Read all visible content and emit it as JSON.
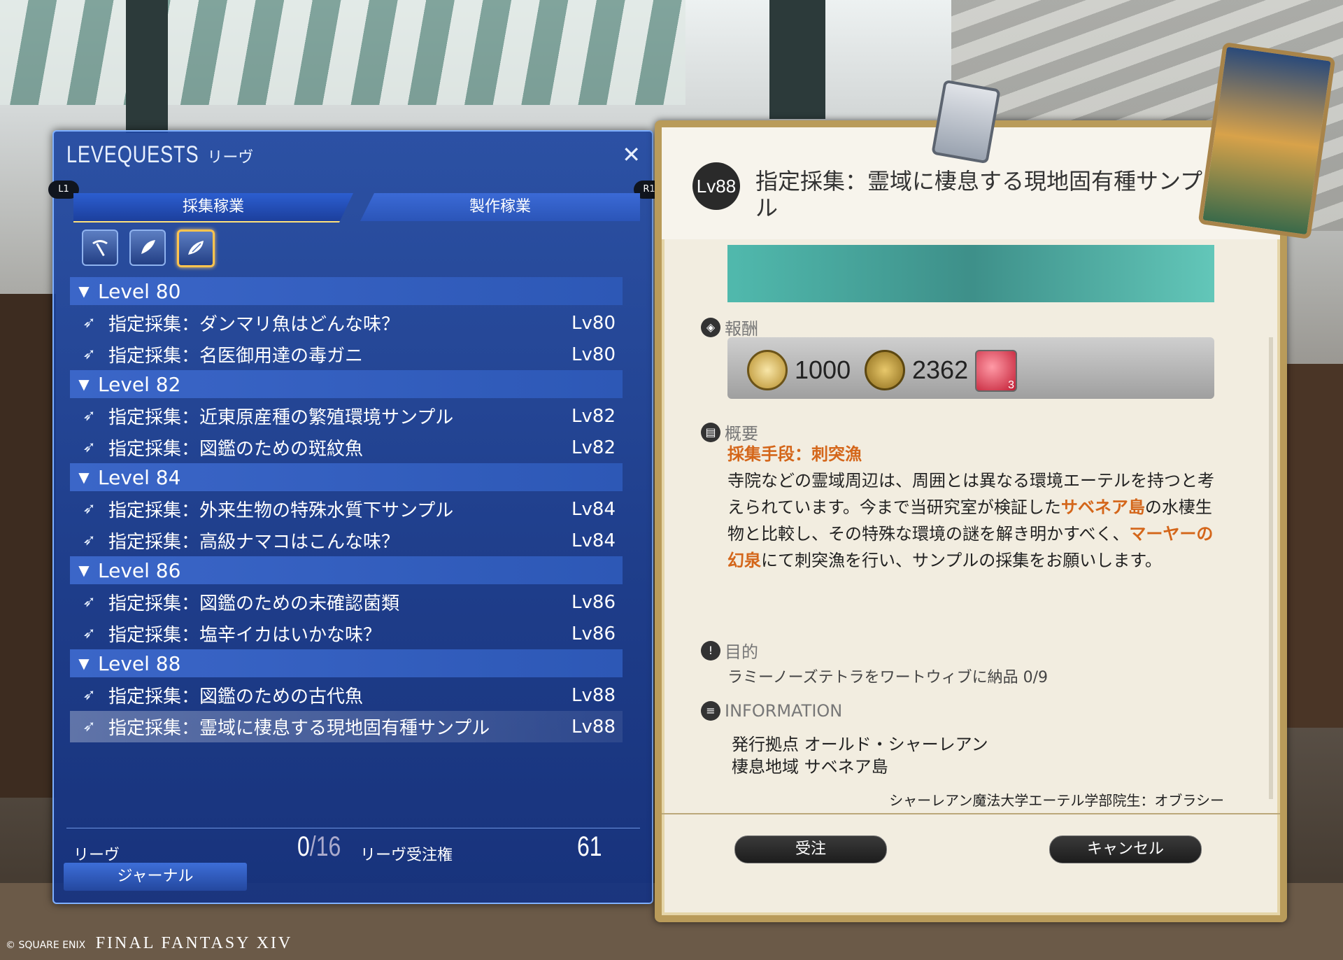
{
  "leve_panel": {
    "title_en": "LEVEQUESTS",
    "title_jp": "リーヴ",
    "close": "✕",
    "shoulder_left": "L1",
    "shoulder_right": "R1",
    "tabs": [
      "採集稼業",
      "製作稼業"
    ],
    "groups": [
      {
        "label": "Level 80",
        "quests": [
          {
            "name": "指定採集：ダンマリ魚はどんな味？",
            "lv": "Lv80"
          },
          {
            "name": "指定採集：名医御用達の毒ガニ",
            "lv": "Lv80"
          }
        ]
      },
      {
        "label": "Level 82",
        "quests": [
          {
            "name": "指定採集：近東原産種の繁殖環境サンプル",
            "lv": "Lv82"
          },
          {
            "name": "指定採集：図鑑のための斑紋魚",
            "lv": "Lv82"
          }
        ]
      },
      {
        "label": "Level 84",
        "quests": [
          {
            "name": "指定採集：外来生物の特殊水質下サンプル",
            "lv": "Lv84"
          },
          {
            "name": "指定採集：高級ナマコはこんな味？",
            "lv": "Lv84"
          }
        ]
      },
      {
        "label": "Level 86",
        "quests": [
          {
            "name": "指定採集：図鑑のための未確認菌類",
            "lv": "Lv86"
          },
          {
            "name": "指定採集：塩辛イカはいかな味？",
            "lv": "Lv86"
          }
        ]
      },
      {
        "label": "Level 88",
        "quests": [
          {
            "name": "指定採集：図鑑のための古代魚",
            "lv": "Lv88"
          },
          {
            "name": "指定採集：霊域に棲息する現地固有種サンプル",
            "lv": "Lv88"
          }
        ]
      }
    ],
    "footer": {
      "leve_label": "リーヴ",
      "leve_count": "0",
      "leve_max": "16",
      "allowance_label": "リーヴ受注権",
      "allowance_value": "61",
      "journal_button": "ジャーナル"
    }
  },
  "detail": {
    "level": "Lv88",
    "title": "指定採集：霊域に棲息する現地固有種サンプル",
    "reward_label": "報酬",
    "rewards": {
      "seals": "1000",
      "gil": "2362",
      "item_qty": "3"
    },
    "summary_label": "概要",
    "method": "採集手段：刺突漁",
    "summary_parts": [
      {
        "text": "寺院などの霊域周辺は、周囲とは異なる環境エーテルを持つと考えられています。今まで当研究室が検証した",
        "hl": false
      },
      {
        "text": "サベネア島",
        "hl": true
      },
      {
        "text": "の水棲生物と比較し、その特殊な環境の謎を解き明かすべく、",
        "hl": false
      },
      {
        "text": "マーヤーの幻泉",
        "hl": true
      },
      {
        "text": "にて刺突漁を行い、サンプルの採集をお願いします。",
        "hl": false
      }
    ],
    "objective_label": "目的",
    "objective": "ラミーノーズテトラをワートウィブに納品 0/9",
    "info_label": "INFORMATION",
    "info_lines": [
      "発行拠点 オールド・シャーレアン",
      "棲息地域 サベネア島"
    ],
    "issuer": "シャーレアン魔法大学エーテル学部院生：オブラシー",
    "accept_button": "受注",
    "cancel_button": "キャンセル"
  },
  "copyright": {
    "company": "© SQUARE ENIX",
    "game": "FINAL FANTASY XIV"
  }
}
